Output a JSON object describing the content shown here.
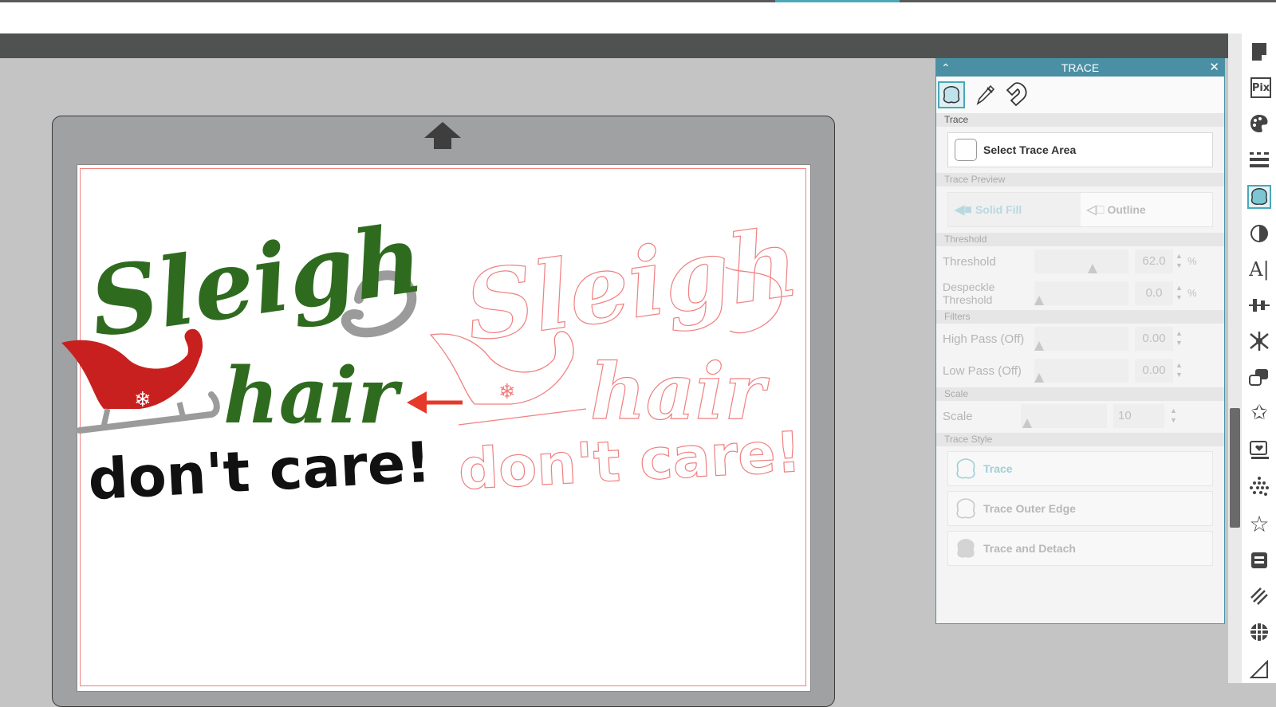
{
  "panel": {
    "title": "TRACE",
    "collapse_glyph": "⌃",
    "close_glyph": "✕",
    "tool_tabs": [
      "trace-tab-icon",
      "eyedropper-icon",
      "magnet-icon"
    ],
    "sections": {
      "trace": "Trace",
      "trace_preview": "Trace Preview",
      "threshold": "Threshold",
      "filters": "Filters",
      "scale": "Scale",
      "trace_style": "Trace Style"
    },
    "select_trace_area": "Select Trace Area",
    "preview": {
      "solid_fill": "Solid Fill",
      "outline": "Outline"
    },
    "params": {
      "threshold": {
        "label": "Threshold",
        "value": "62.0",
        "unit": "%",
        "level": 0.62
      },
      "despeckle": {
        "label_line1": "Despeckle",
        "label_line2": "Threshold",
        "value": "0.0",
        "unit": "%",
        "level": 0
      },
      "high_pass": {
        "label": "High Pass (Off)",
        "value": "0.00",
        "level": 0
      },
      "low_pass": {
        "label": "Low Pass (Off)",
        "value": "0.00",
        "level": 0
      },
      "scale": {
        "label": "Scale",
        "value": "10",
        "level": 0
      }
    },
    "styles": {
      "trace": "Trace",
      "outer_edge": "Trace Outer Edge",
      "detach": "Trace and Detach"
    }
  },
  "canvas": {
    "design_line1": "Sleigh",
    "design_line2": "hair",
    "design_line3": "don't care!",
    "colors": {
      "green": "#2f6b1f",
      "red": "#c7201f",
      "black": "#111111",
      "outline": "#f08080",
      "arrow": "#e53a2a",
      "accent": "#4aa8b8"
    }
  },
  "iconbar": [
    "page-setup-icon",
    "pixscan-icon",
    "fill-palette-icon",
    "line-style-icon",
    "trace-icon",
    "contrast-icon",
    "text-style-icon",
    "align-icon",
    "replicate-icon",
    "modify-icon",
    "offset-icon",
    "sketch-icon",
    "image-effects-icon",
    "design-store-icon",
    "stars-icon",
    "library-icon",
    "stitch-icon",
    "grid-icon",
    "send-icon"
  ]
}
